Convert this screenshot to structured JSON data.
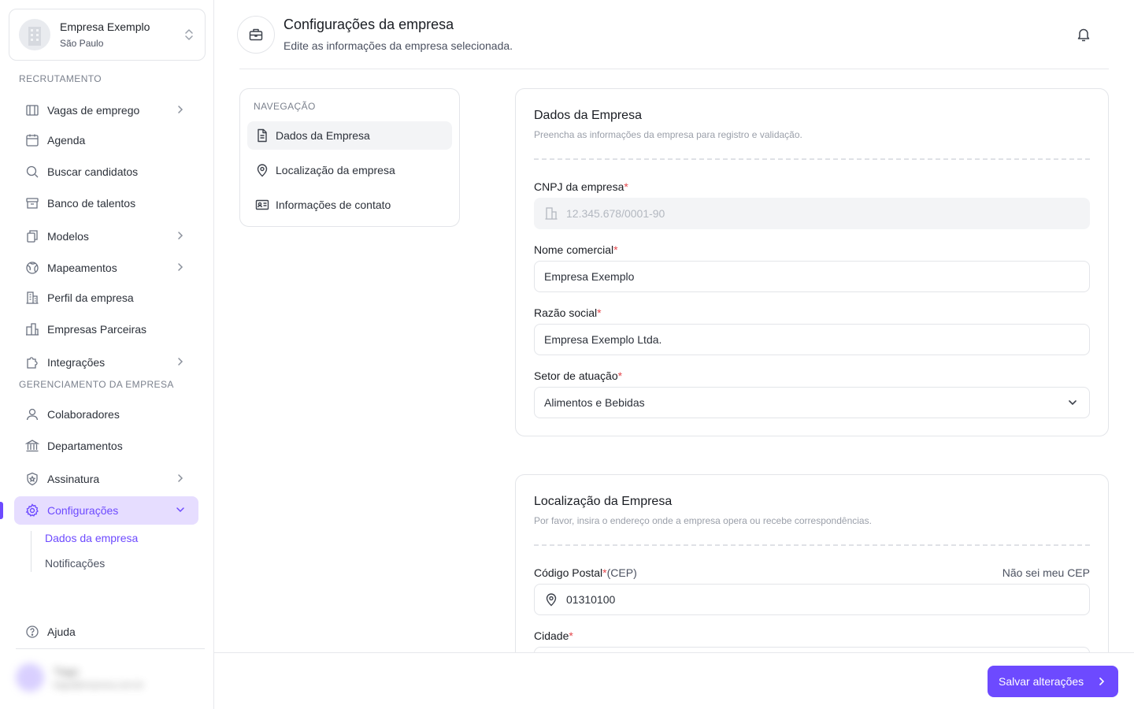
{
  "sidebar": {
    "org": {
      "name": "Empresa Exemplo",
      "city": "São Paulo"
    },
    "sections": {
      "recruitment": "RECRUTAMENTO",
      "management": "GERENCIAMENTO DA EMPRESA"
    },
    "items": [
      {
        "label": "Vagas de emprego",
        "icon": "briefcase-icon",
        "has_submenu": true
      },
      {
        "label": "Agenda",
        "icon": "calendar-icon",
        "has_submenu": false
      },
      {
        "label": "Buscar candidatos",
        "icon": "search-icon",
        "has_submenu": false
      },
      {
        "label": "Banco de talentos",
        "icon": "archive-icon",
        "has_submenu": false
      },
      {
        "label": "Modelos",
        "icon": "copy-icon",
        "has_submenu": true
      },
      {
        "label": "Mapeamentos",
        "icon": "globe-icon",
        "has_submenu": true
      },
      {
        "label": "Perfil da empresa",
        "icon": "building-icon",
        "has_submenu": false
      },
      {
        "label": "Empresas Parceiras",
        "icon": "buildings-icon",
        "has_submenu": false
      },
      {
        "label": "Integrações",
        "icon": "puzzle-icon",
        "has_submenu": true
      },
      {
        "label": "Colaboradores",
        "icon": "user-icon",
        "has_submenu": false
      },
      {
        "label": "Departamentos",
        "icon": "bank-icon",
        "has_submenu": false
      },
      {
        "label": "Assinatura",
        "icon": "shield-star-icon",
        "has_submenu": true
      },
      {
        "label": "Configurações",
        "icon": "gear-icon",
        "has_submenu": true,
        "active": true
      }
    ],
    "subitems": [
      {
        "label": "Dados da empresa",
        "active": true
      },
      {
        "label": "Notificações",
        "active": false
      }
    ],
    "help_label": "Ajuda",
    "user": {
      "name": "Tiago",
      "email": "tiago@empresa.com.br"
    }
  },
  "header": {
    "title": "Configurações da empresa",
    "subtitle": "Edite as informações da empresa selecionada."
  },
  "subnav": {
    "label": "NAVEGAÇÃO",
    "items": [
      {
        "label": "Dados da Empresa",
        "icon": "document-icon",
        "active": true
      },
      {
        "label": "Localização da empresa",
        "icon": "map-pin-icon",
        "active": false
      },
      {
        "label": "Informações de contato",
        "icon": "id-card-icon",
        "active": false
      }
    ]
  },
  "company_card": {
    "title": "Dados da Empresa",
    "description": "Preencha as informações da empresa para registro e validação.",
    "cnpj": {
      "label": "CNPJ da empresa",
      "value": "12.345.678/0001-90"
    },
    "trade_name": {
      "label": "Nome comercial",
      "value": "Empresa Exemplo"
    },
    "legal_name": {
      "label": "Razão social",
      "value": "Empresa Exemplo Ltda."
    },
    "sector": {
      "label": "Setor de atuação",
      "value": "Alimentos e Bebidas"
    }
  },
  "location_card": {
    "title": "Localização da Empresa",
    "description": "Por favor, insira o endereço onde a empresa opera ou recebe correspondências.",
    "postal_code": {
      "label": "Código Postal",
      "hint": "(CEP)",
      "aside": "Não sei meu CEP",
      "value": "01310100"
    },
    "city": {
      "label": "Cidade",
      "value": ""
    }
  },
  "footer": {
    "save_label": "Salvar alterações"
  },
  "colors": {
    "accent": "#6d4aff",
    "accent_soft": "#e6ddff",
    "required": "#e5484d"
  }
}
